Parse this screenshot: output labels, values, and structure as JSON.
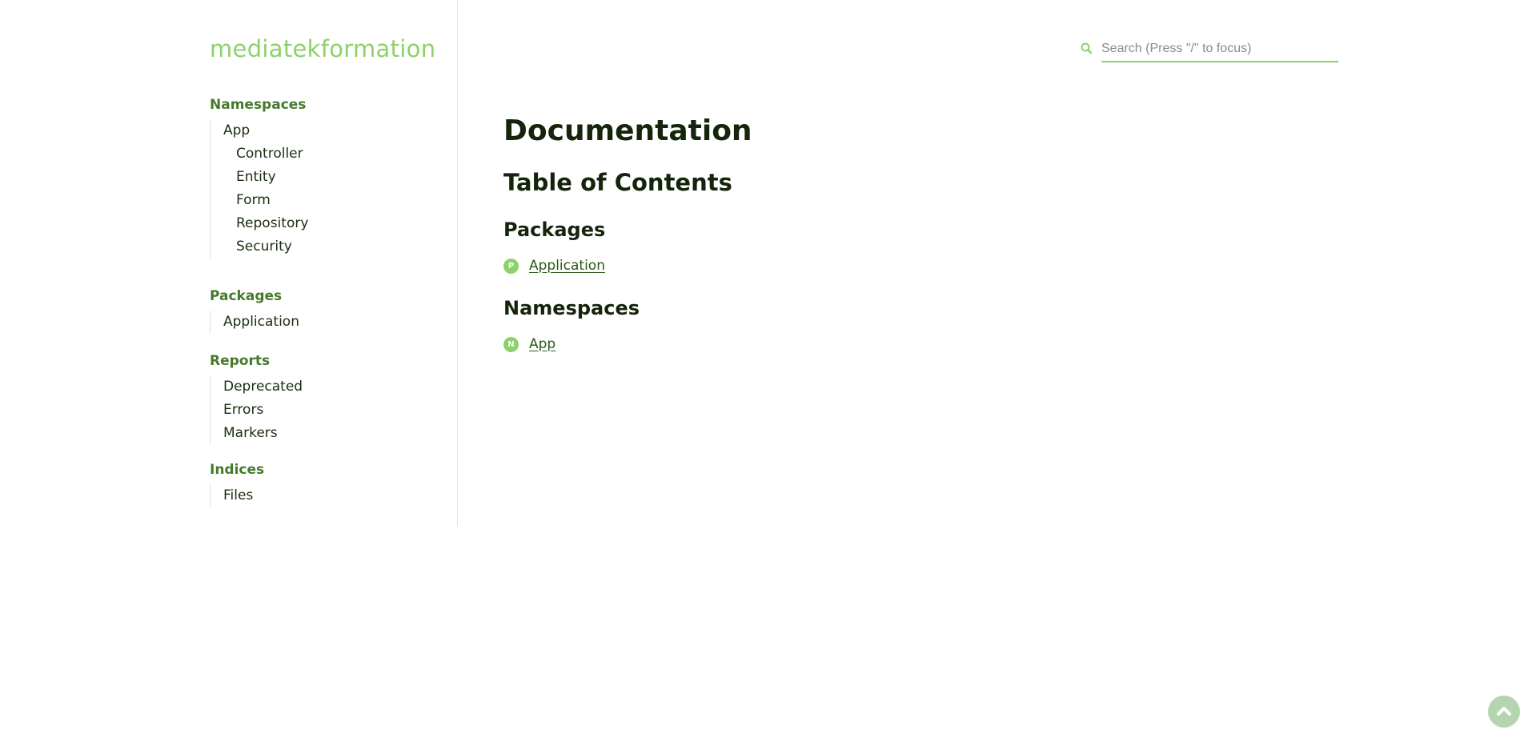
{
  "site": {
    "title": "mediatekformation"
  },
  "search": {
    "placeholder": "Search (Press \"/\" to focus)",
    "value": ""
  },
  "sidebar": {
    "namespaces": {
      "heading": "Namespaces",
      "items": [
        "App",
        "Controller",
        "Entity",
        "Form",
        "Repository",
        "Security"
      ]
    },
    "packages": {
      "heading": "Packages",
      "items": [
        "Application"
      ]
    },
    "reports": {
      "heading": "Reports",
      "items": [
        "Deprecated",
        "Errors",
        "Markers"
      ]
    },
    "indices": {
      "heading": "Indices",
      "items": [
        "Files"
      ]
    }
  },
  "main": {
    "title": "Documentation",
    "toc_title": "Table of Contents",
    "packages_heading": "Packages",
    "packages": [
      {
        "badge": "P",
        "label": "Application"
      }
    ],
    "namespaces_heading": "Namespaces",
    "namespaces": [
      {
        "badge": "N",
        "label": "App"
      }
    ]
  },
  "icons": {
    "search": "search-icon",
    "back_to_top": "chevron-up-icon"
  },
  "colors": {
    "accent": "#8cd169",
    "heading_green": "#467a2b",
    "link": "#2a5a16",
    "text": "#1a2e10"
  }
}
